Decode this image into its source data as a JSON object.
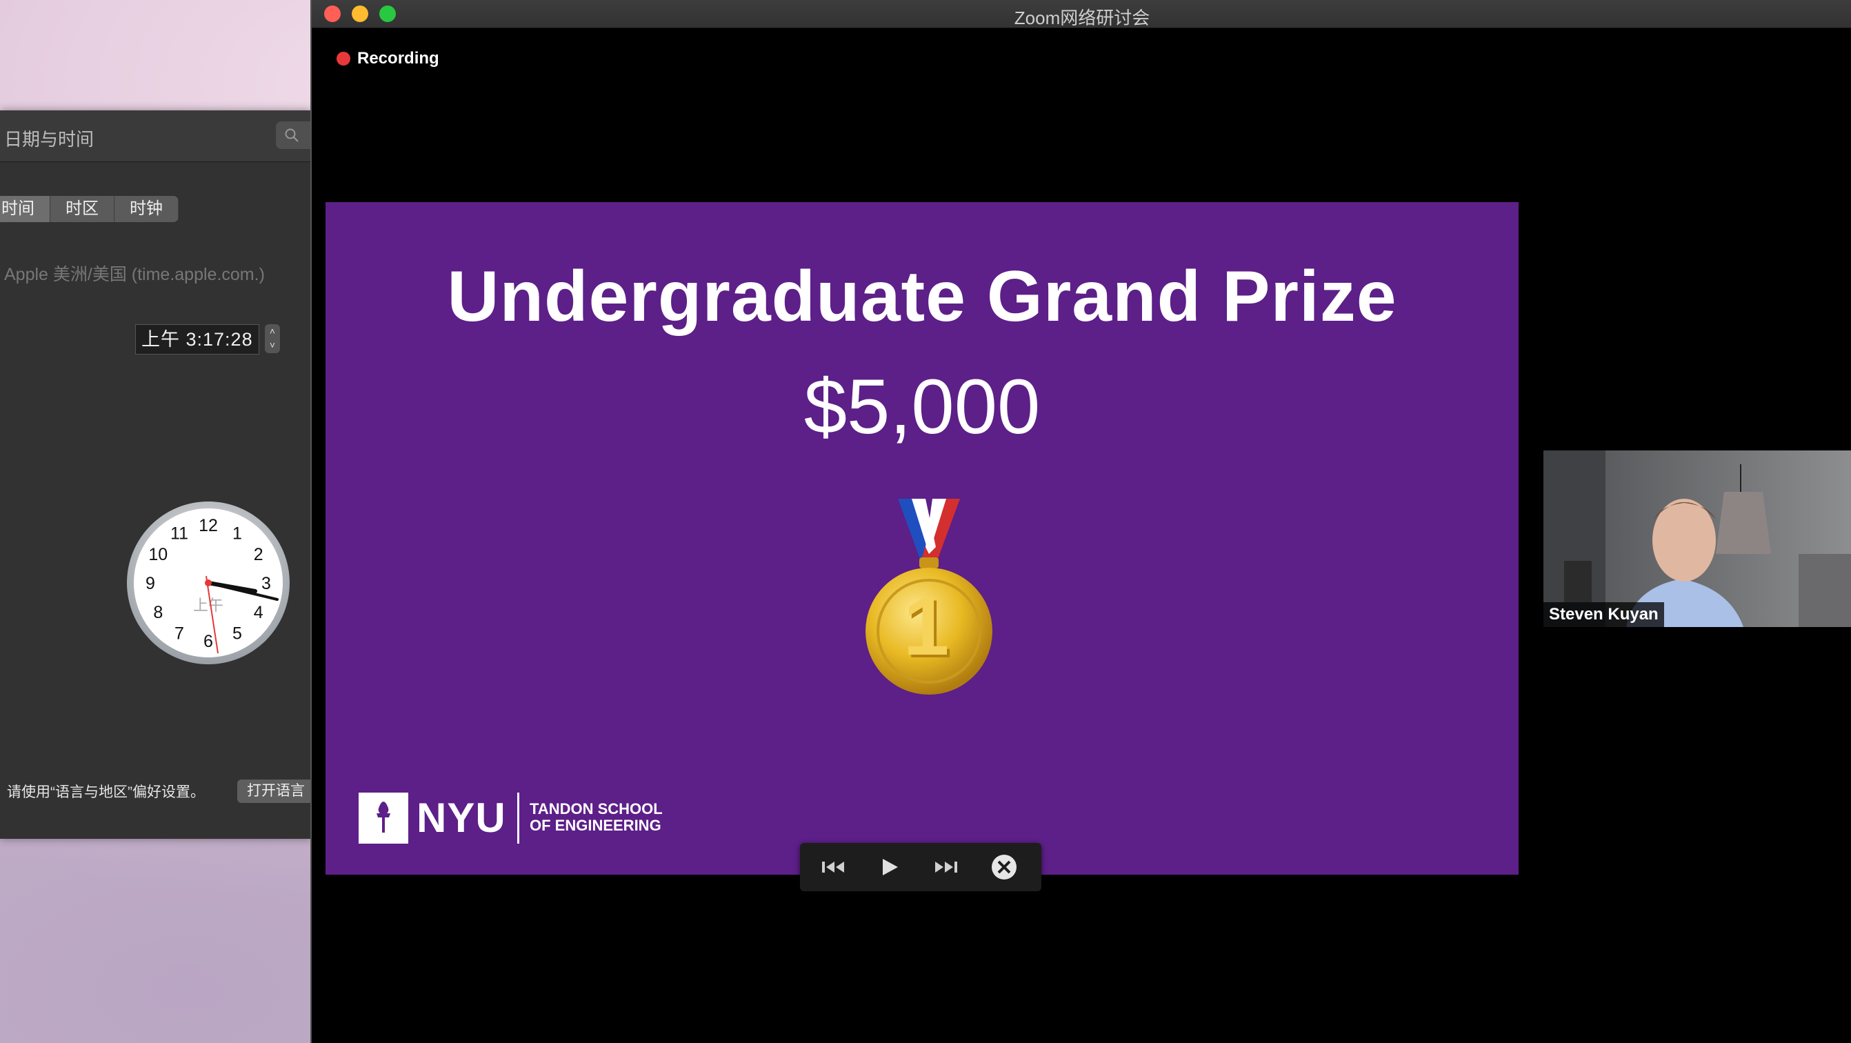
{
  "prefs": {
    "title": "日期与时间",
    "tabs": [
      "时间",
      "时区",
      "时钟"
    ],
    "time_server": "Apple 美洲/美国 (time.apple.com.)",
    "time_value": "上午  3:17:28",
    "clock_am_label": "上午",
    "clock_numbers": [
      "12",
      "1",
      "2",
      "3",
      "4",
      "5",
      "6",
      "7",
      "8",
      "9",
      "10",
      "11"
    ],
    "hint": "请使用“语言与地区”偏好设置。",
    "open_button": "打开语言"
  },
  "zoom": {
    "window_title": "Zoom网络研讨会",
    "recording_label": "Recording",
    "slide": {
      "title": "Undergraduate Grand Prize",
      "amount": "$5,000",
      "logo_text": "NYU",
      "school_line1": "TANDON SCHOOL",
      "school_line2": "OF ENGINEERING",
      "slide_bg_color": "#5d1f88"
    },
    "participant_name": "Steven Kuyan",
    "controls": [
      "previous-icon",
      "play-icon",
      "next-icon",
      "close-icon"
    ]
  },
  "colors": {
    "record": "#e8393a",
    "close": "#ff5f57",
    "minimize": "#febc2e",
    "maximize": "#28c840"
  }
}
